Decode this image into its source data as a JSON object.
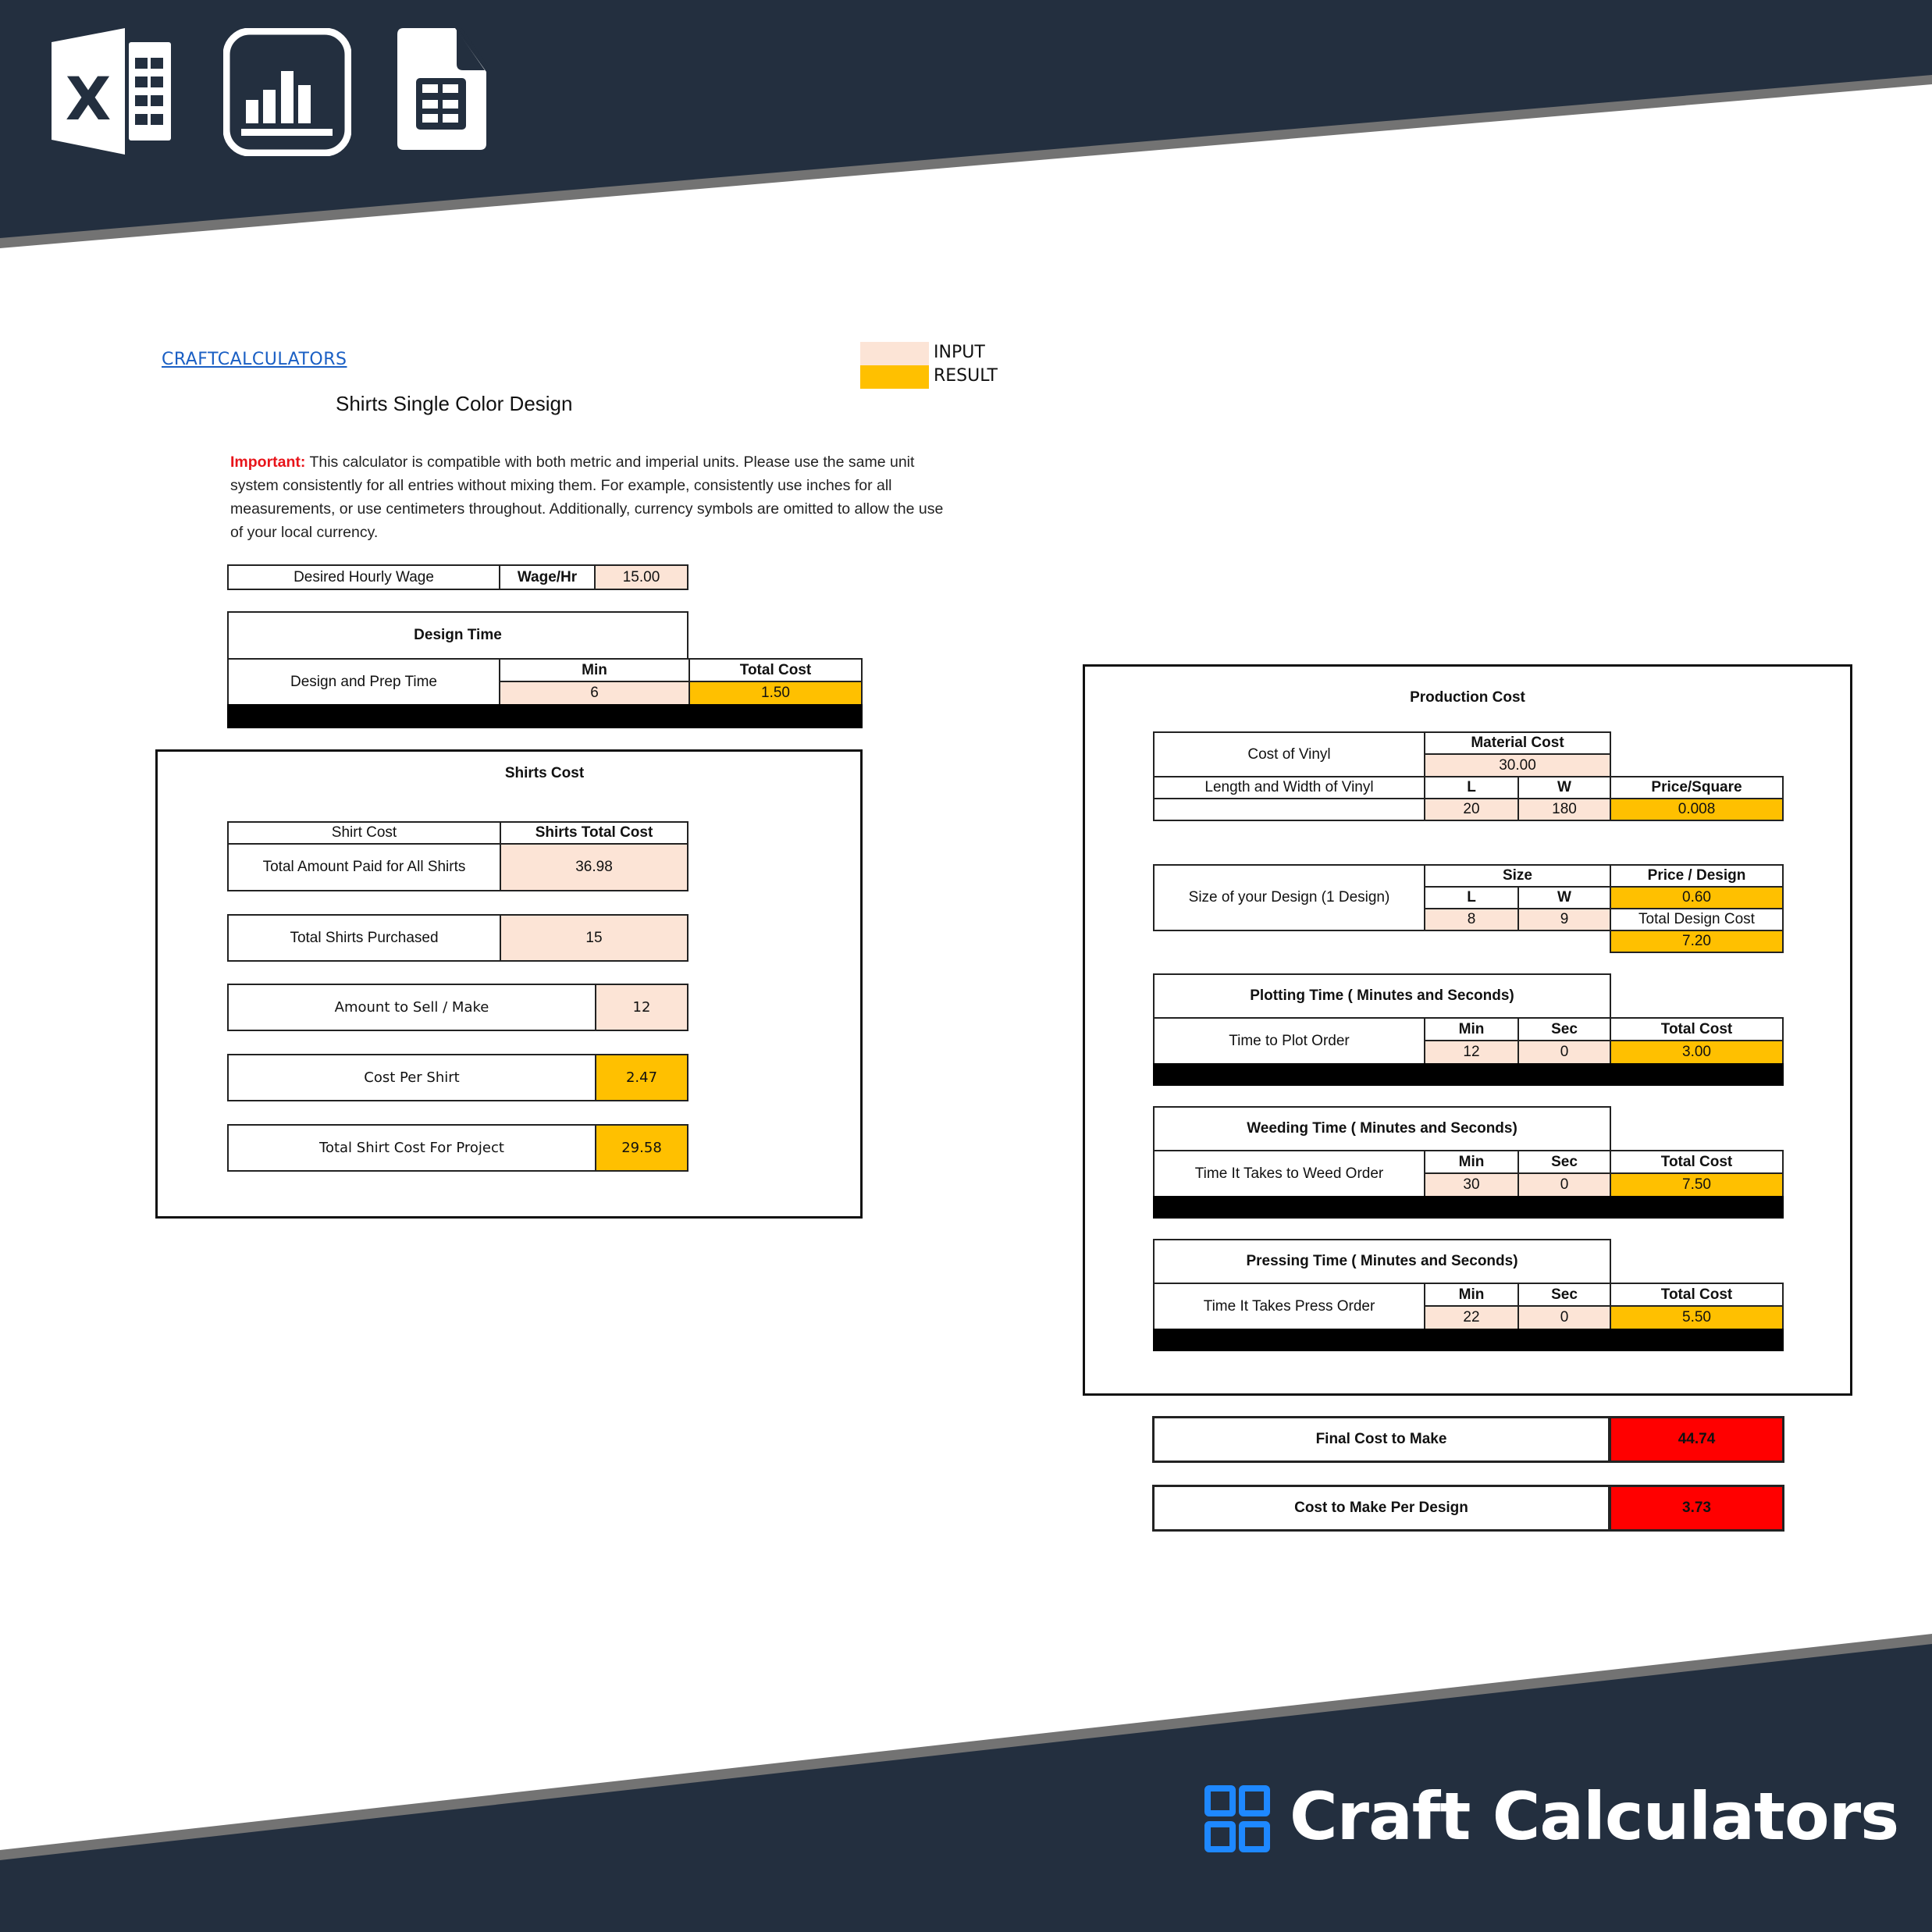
{
  "header": {
    "icons": [
      "excel-icon",
      "bar-chart-icon",
      "spreadsheet-file-icon"
    ]
  },
  "colors": {
    "banner": "#232f3f",
    "banner_edge": "#737373",
    "input": "#fce4d6",
    "result": "#ffc000",
    "final": "#ff0000",
    "brand_accent": "#1e88ff"
  },
  "sheet": {
    "link": "CRAFTCALCULATORS",
    "title": "Shirts Single Color Design",
    "legend": {
      "input": "INPUT",
      "result": "RESULT"
    },
    "note_label": "Important:",
    "note_text": " This calculator is compatible with both metric and imperial units. Please use the same unit system consistently for all entries without mixing them. For example, consistently use inches for all measurements, or use centimeters throughout. Additionally, currency symbols are omitted to allow the use of your local currency."
  },
  "wage": {
    "label": "Desired Hourly Wage",
    "unit": "Wage/Hr",
    "value": "15.00"
  },
  "design_time": {
    "title": "Design Time",
    "label": "Design and Prep Time",
    "min_header": "Min",
    "cost_header": "Total Cost",
    "min": "6",
    "total_cost": "1.50"
  },
  "shirts_cost": {
    "title": "Shirts Cost",
    "col1_header": "Shirt Cost",
    "col2_header": "Shirts Total Cost",
    "rows": [
      {
        "label": "Total Amount Paid for All Shirts",
        "value": "36.98"
      },
      {
        "label": "Total Shirts Purchased",
        "value": "15"
      },
      {
        "label": "Amount to Sell / Make",
        "value": "12"
      },
      {
        "label": "Cost Per Shirt",
        "value": "2.47"
      },
      {
        "label": "Total Shirt Cost For Project",
        "value": "29.58"
      }
    ]
  },
  "production": {
    "title": "Production Cost",
    "vinyl": {
      "cost_label": "Cost of Vinyl",
      "material_header": "Material Cost",
      "material_cost": "30.00",
      "size_label": "Length and Width of Vinyl",
      "l_header": "L",
      "w_header": "W",
      "price_header": "Price/Square",
      "l": "20",
      "w": "180",
      "price_square": "0.008"
    },
    "design_size": {
      "label": "Size of your Design (1 Design)",
      "size_header": "Size",
      "l_header": "L",
      "w_header": "W",
      "price_header": "Price / Design",
      "price_design": "0.60",
      "l": "8",
      "w": "9",
      "total_label": "Total Design Cost",
      "total_design_cost": "7.20"
    },
    "timings": [
      {
        "title": "Plotting Time ( Minutes and Seconds)",
        "label": "Time to Plot Order",
        "min_header": "Min",
        "sec_header": "Sec",
        "cost_header": "Total Cost",
        "min": "12",
        "sec": "0",
        "cost": "3.00"
      },
      {
        "title": "Weeding Time ( Minutes and Seconds)",
        "label": "Time It Takes to Weed Order",
        "min_header": "Min",
        "sec_header": "Sec",
        "cost_header": "Total Cost",
        "min": "30",
        "sec": "0",
        "cost": "7.50"
      },
      {
        "title": "Pressing Time ( Minutes and Seconds)",
        "label": "Time It Takes Press Order",
        "min_header": "Min",
        "sec_header": "Sec",
        "cost_header": "Total Cost",
        "min": "22",
        "sec": "0",
        "cost": "5.50"
      }
    ]
  },
  "totals": {
    "final_label": "Final Cost to Make",
    "final_value": "44.74",
    "per_design_label": "Cost to Make Per Design",
    "per_design_value": "3.73"
  },
  "footer": {
    "brand": "Craft Calculators"
  }
}
